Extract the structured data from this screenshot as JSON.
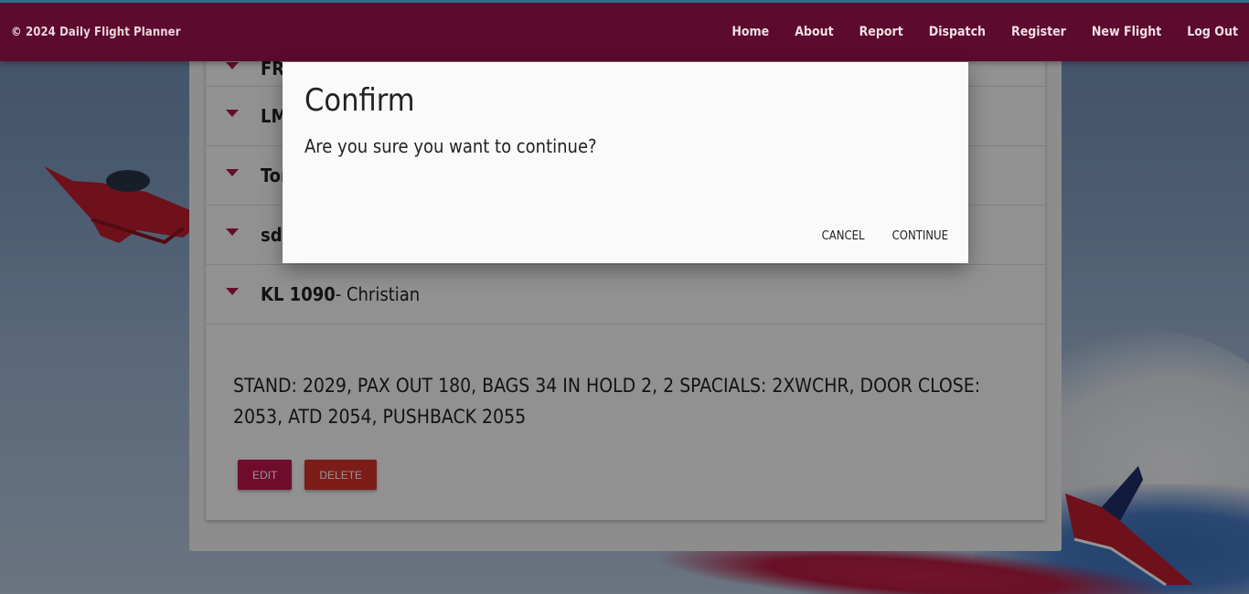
{
  "navbar": {
    "brand": "© 2024 Daily Flight Planner",
    "links": [
      "Home",
      "About",
      "Report",
      "Dispatch",
      "Register",
      "New Flight",
      "Log Out"
    ]
  },
  "flights": [
    {
      "code": "FR",
      "name": "- "
    },
    {
      "code": "LM",
      "name": ""
    },
    {
      "code": "Tor",
      "name": ""
    },
    {
      "code": "sdf",
      "name": ""
    },
    {
      "code": "KL 1090",
      "name": "- Christian"
    }
  ],
  "expanded": {
    "details": "STAND: 2029, PAX OUT 180, BAGS 34 IN HOLD 2, 2 SPACIALS: 2XWCHR, DOOR CLOSE: 2053, ATD 2054, PUSHBACK 2055",
    "edit_label": "EDIT",
    "delete_label": "DELETE"
  },
  "modal": {
    "title": "Confirm",
    "message": "Are you sure you want to continue?",
    "cancel_label": "CANCEL",
    "continue_label": "CONTINUE"
  },
  "colors": {
    "navbar": "#5c0a2d",
    "accent": "#c0154d",
    "delete": "#d6322d"
  }
}
